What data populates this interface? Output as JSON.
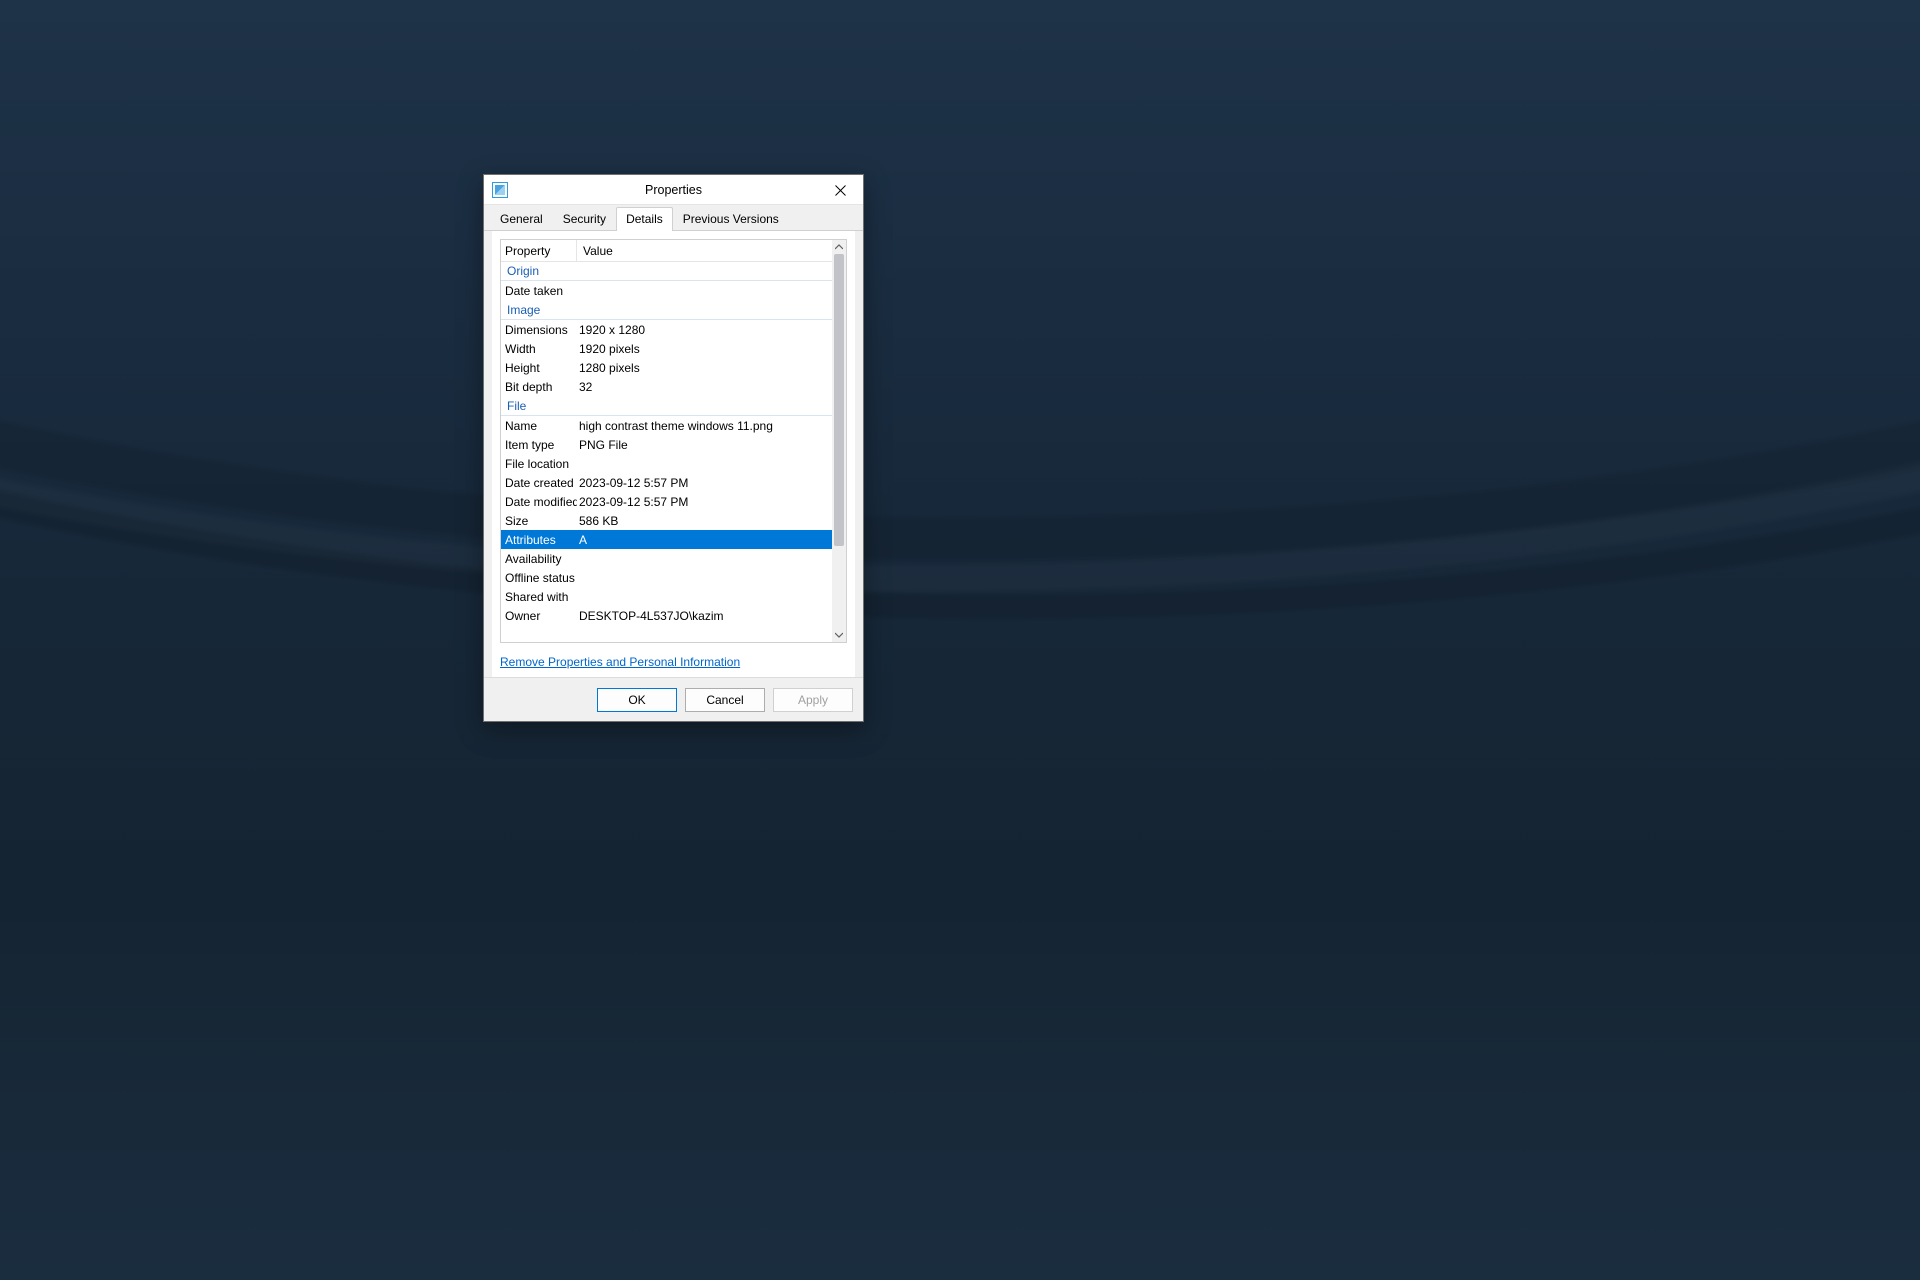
{
  "window": {
    "title": "Properties"
  },
  "tabs": {
    "general": "General",
    "security": "Security",
    "details": "Details",
    "previous": "Previous Versions"
  },
  "columns": {
    "property": "Property",
    "value": "Value"
  },
  "groups": {
    "origin": "Origin",
    "image": "Image",
    "file": "File"
  },
  "props": {
    "date_taken": "Date taken",
    "dimensions": "Dimensions",
    "width": "Width",
    "height": "Height",
    "bit_depth": "Bit depth",
    "name": "Name",
    "item_type": "Item type",
    "file_location": "File location",
    "date_created": "Date created",
    "date_modified": "Date modified",
    "size": "Size",
    "attributes": "Attributes",
    "availability": "Availability",
    "offline_status": "Offline status",
    "shared_with": "Shared with",
    "owner": "Owner"
  },
  "vals": {
    "date_taken": "",
    "dimensions": "1920 x 1280",
    "width": "1920 pixels",
    "height": "1280 pixels",
    "bit_depth": "32",
    "name": "high contrast theme windows 11.png",
    "item_type": "PNG File",
    "file_location": "",
    "date_created": "2023-09-12 5:57 PM",
    "date_modified": "2023-09-12 5:57 PM",
    "size": "586 KB",
    "attributes": "A",
    "availability": "",
    "offline_status": "",
    "shared_with": "",
    "owner": "DESKTOP-4L537JO\\kazim"
  },
  "link": {
    "remove_personal": "Remove Properties and Personal Information"
  },
  "buttons": {
    "ok": "OK",
    "cancel": "Cancel",
    "apply": "Apply"
  }
}
